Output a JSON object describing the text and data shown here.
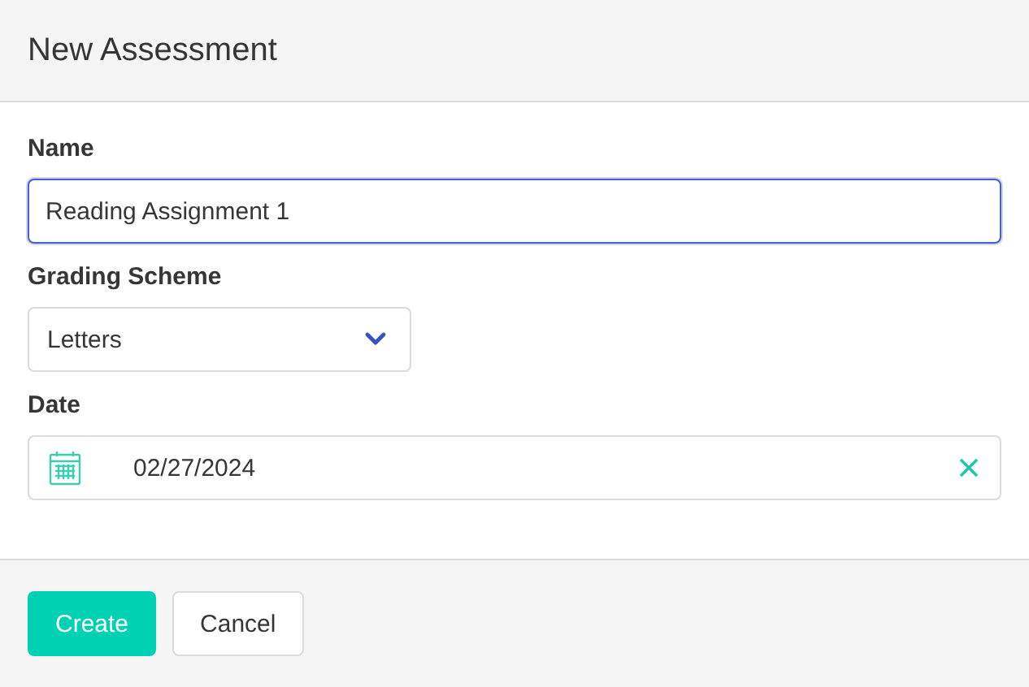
{
  "window": {
    "title": "New Assessment"
  },
  "fields": [
    {
      "kind": "text",
      "label": "Name",
      "value": "Reading Assignment 1",
      "focused": true
    },
    {
      "kind": "select",
      "label": "Grading Scheme",
      "value": "Letters",
      "focused": false
    },
    {
      "kind": "date",
      "label": "Date",
      "value": "02/27/2024",
      "focused": false
    }
  ],
  "buttons": [
    {
      "label": "Create",
      "kind": "primary"
    },
    {
      "label": "Cancel",
      "kind": "default"
    }
  ]
}
